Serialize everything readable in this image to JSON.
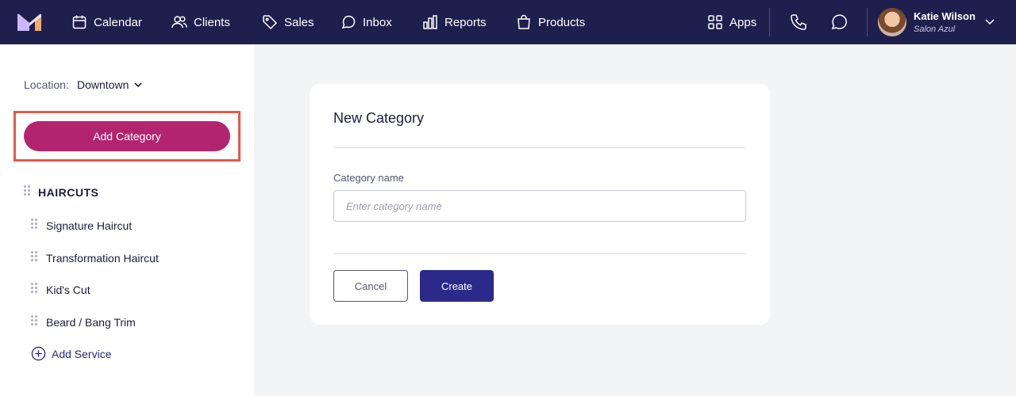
{
  "nav": {
    "items": [
      {
        "label": "Calendar",
        "icon": "calendar-icon"
      },
      {
        "label": "Clients",
        "icon": "users-icon"
      },
      {
        "label": "Sales",
        "icon": "tag-icon"
      },
      {
        "label": "Inbox",
        "icon": "chat-icon"
      },
      {
        "label": "Reports",
        "icon": "bar-chart-icon"
      },
      {
        "label": "Products",
        "icon": "shopping-bag-icon"
      }
    ],
    "apps_label": "Apps",
    "user": {
      "name": "Katie Wilson",
      "salon": "Salon Azul"
    }
  },
  "sidebar": {
    "location_label": "Location:",
    "location_value": "Downtown",
    "add_category_label": "Add Category",
    "group_title": "HAIRCUTS",
    "services": [
      "Signature Haircut",
      "Transformation Haircut",
      "Kid's Cut",
      "Beard / Bang Trim"
    ],
    "add_service_label": "Add Service"
  },
  "card": {
    "title": "New Category",
    "field_label": "Category name",
    "field_placeholder": "Enter category name",
    "cancel_label": "Cancel",
    "create_label": "Create"
  },
  "colors": {
    "nav_bg": "#1f1f4e",
    "brand_button": "#b3246f",
    "primary_button": "#2b2a8a",
    "highlight_border": "#e35a4c",
    "link": "#26287a"
  }
}
